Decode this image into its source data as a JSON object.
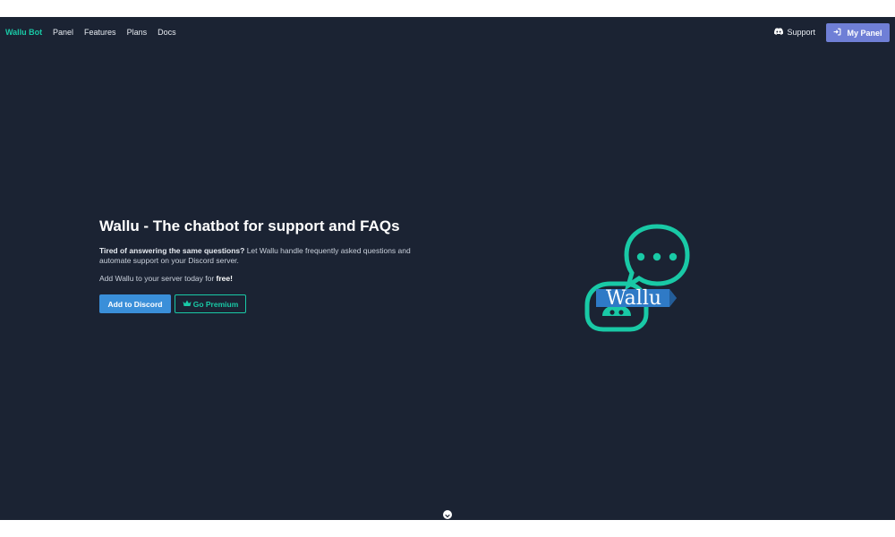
{
  "nav": {
    "brand": "Wallu Bot",
    "links": [
      "Panel",
      "Features",
      "Plans",
      "Docs"
    ],
    "support_label": "Support",
    "my_panel_label": "My Panel"
  },
  "hero": {
    "title": "Wallu - The chatbot for support and FAQs",
    "description_bold": "Tired of answering the same questions?",
    "description_rest": " Let Wallu handle frequently asked questions and automate support on your Discord server.",
    "cta_text": "Add Wallu to your server today for ",
    "cta_bold": "free!",
    "add_button_label": "Add to Discord",
    "premium_button_label": "Go Premium"
  },
  "logo": {
    "text": "Wallu"
  },
  "icons": {
    "support": "discord-icon",
    "my_panel": "sign-in-icon",
    "premium": "crown-icon",
    "scroll": "chevron-down-icon"
  },
  "colors": {
    "background": "#1b2333",
    "brand": "#19c9a6",
    "primary_button": "#3a8fd9",
    "panel_button": "#6f7fd6",
    "logo_ribbon": "#2f7ac6"
  }
}
